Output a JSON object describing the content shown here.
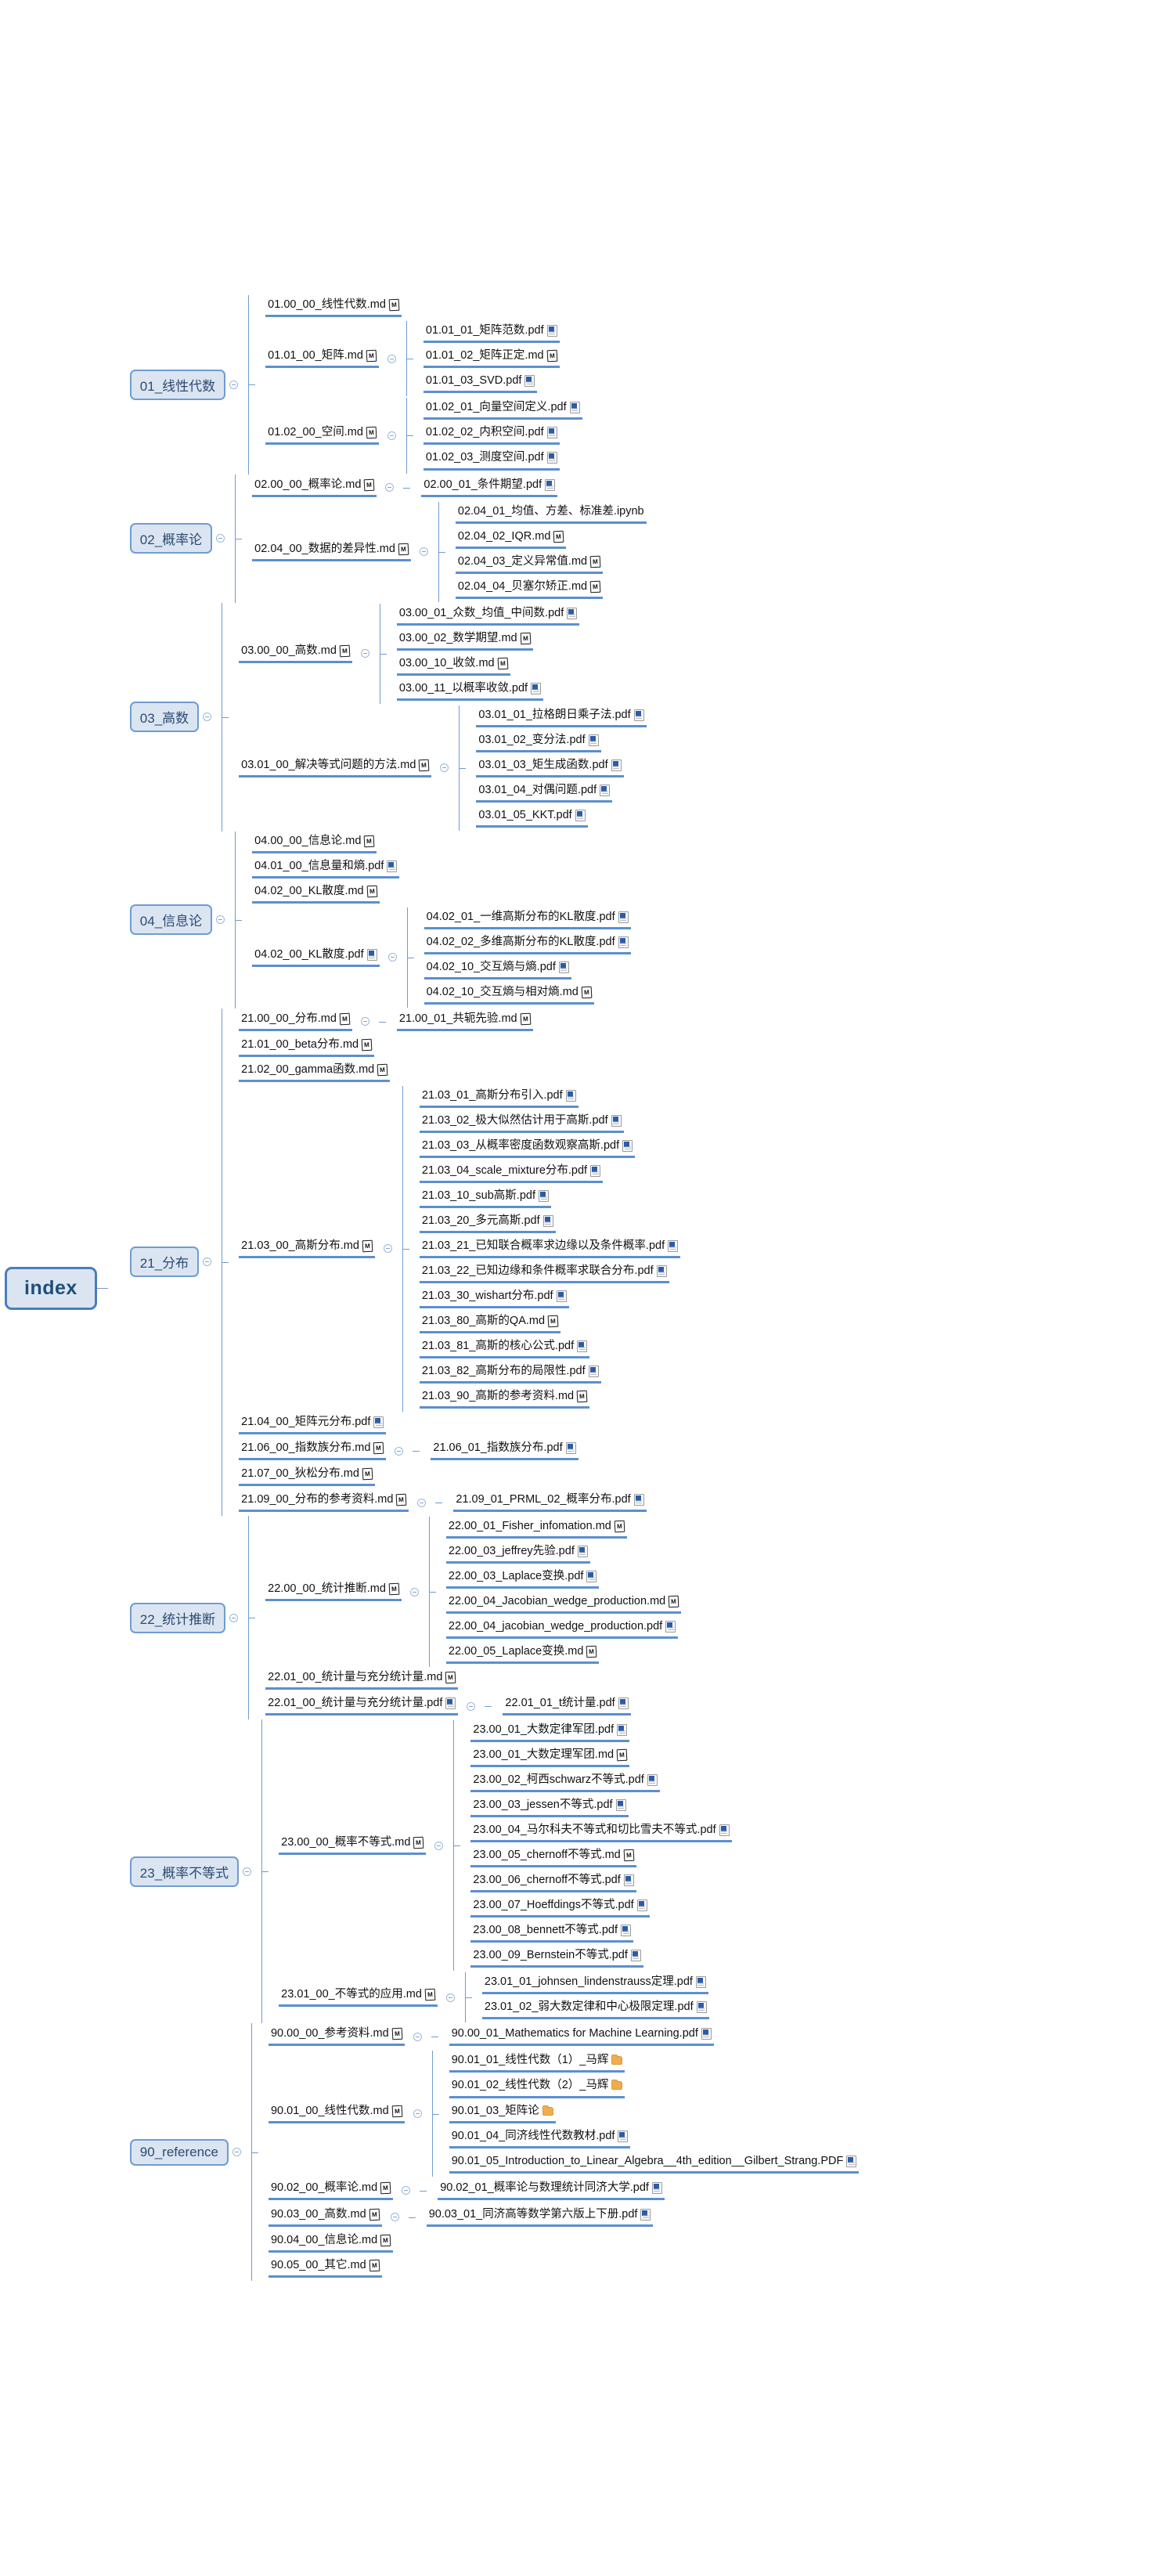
{
  "root": {
    "label": "index"
  },
  "colors": {
    "node_fill": "#dbe5f1",
    "node_border": "#6f9cd1",
    "root_border": "#4a7ebb",
    "root_text": "#1f4e79",
    "underline": "#5b8fd0",
    "connector": "#6f9cd1",
    "pdf_icon": "#2a5caa",
    "folder_icon": "#f0ad4e"
  },
  "toggle_label": "collapse-toggle",
  "branches": [
    {
      "label": "01_线性代数",
      "children": [
        {
          "label": "01.00_00_线性代数.md",
          "icon": "md-file-icon",
          "children": []
        },
        {
          "label": "01.01_00_矩阵.md",
          "icon": "md-file-icon",
          "children": [
            {
              "label": "01.01_01_矩阵范数.pdf",
              "icon": "pdf-file-icon"
            },
            {
              "label": "01.01_02_矩阵正定.md",
              "icon": "md-file-icon"
            },
            {
              "label": "01.01_03_SVD.pdf",
              "icon": "pdf-file-icon"
            }
          ]
        },
        {
          "label": "01.02_00_空间.md",
          "icon": "md-file-icon",
          "children": [
            {
              "label": "01.02_01_向量空间定义.pdf",
              "icon": "pdf-file-icon"
            },
            {
              "label": "01.02_02_内积空间.pdf",
              "icon": "pdf-file-icon"
            },
            {
              "label": "01.02_03_测度空间.pdf",
              "icon": "pdf-file-icon"
            }
          ]
        }
      ]
    },
    {
      "label": "02_概率论",
      "children": [
        {
          "label": "02.00_00_概率论.md",
          "icon": "md-file-icon",
          "children": [
            {
              "label": "02.00_01_条件期望.pdf",
              "icon": "pdf-file-icon"
            }
          ]
        },
        {
          "label": "02.04_00_数据的差异性.md",
          "icon": "md-file-icon",
          "children": [
            {
              "label": "02.04_01_均值、方差、标准差.ipynb",
              "icon": "none"
            },
            {
              "label": "02.04_02_IQR.md",
              "icon": "md-file-icon"
            },
            {
              "label": "02.04_03_定义异常值.md",
              "icon": "md-file-icon"
            },
            {
              "label": "02.04_04_贝塞尔矫正.md",
              "icon": "md-file-icon"
            }
          ]
        }
      ]
    },
    {
      "label": "03_高数",
      "children": [
        {
          "label": "03.00_00_高数.md",
          "icon": "md-file-icon",
          "children": [
            {
              "label": "03.00_01_众数_均值_中间数.pdf",
              "icon": "pdf-file-icon"
            },
            {
              "label": "03.00_02_数学期望.md",
              "icon": "md-file-icon"
            },
            {
              "label": "03.00_10_收敛.md",
              "icon": "md-file-icon"
            },
            {
              "label": "03.00_11_以概率收敛.pdf",
              "icon": "pdf-file-icon"
            }
          ]
        },
        {
          "label": "03.01_00_解决等式问题的方法.md",
          "icon": "md-file-icon",
          "children": [
            {
              "label": "03.01_01_拉格朗日乘子法.pdf",
              "icon": "pdf-file-icon"
            },
            {
              "label": "03.01_02_变分法.pdf",
              "icon": "pdf-file-icon"
            },
            {
              "label": "03.01_03_矩生成函数.pdf",
              "icon": "pdf-file-icon"
            },
            {
              "label": "03.01_04_对偶问题.pdf",
              "icon": "pdf-file-icon"
            },
            {
              "label": "03.01_05_KKT.pdf",
              "icon": "pdf-file-icon"
            }
          ]
        }
      ]
    },
    {
      "label": "04_信息论",
      "children": [
        {
          "label": "04.00_00_信息论.md",
          "icon": "md-file-icon",
          "children": []
        },
        {
          "label": "04.01_00_信息量和熵.pdf",
          "icon": "pdf-file-icon",
          "children": []
        },
        {
          "label": "04.02_00_KL散度.md",
          "icon": "md-file-icon",
          "children": []
        },
        {
          "label": "04.02_00_KL散度.pdf",
          "icon": "pdf-file-icon",
          "children": [
            {
              "label": "04.02_01_一维高斯分布的KL散度.pdf",
              "icon": "pdf-file-icon"
            },
            {
              "label": "04.02_02_多维高斯分布的KL散度.pdf",
              "icon": "pdf-file-icon"
            },
            {
              "label": "04.02_10_交互熵与熵.pdf",
              "icon": "pdf-file-icon"
            },
            {
              "label": "04.02_10_交互熵与相对熵.md",
              "icon": "md-file-icon"
            }
          ]
        }
      ]
    },
    {
      "label": "21_分布",
      "children": [
        {
          "label": "21.00_00_分布.md",
          "icon": "md-file-icon",
          "children": [
            {
              "label": "21.00_01_共轭先验.md",
              "icon": "md-file-icon"
            }
          ]
        },
        {
          "label": "21.01_00_beta分布.md",
          "icon": "md-file-icon",
          "children": []
        },
        {
          "label": "21.02_00_gamma函数.md",
          "icon": "md-file-icon",
          "children": []
        },
        {
          "label": "21.03_00_高斯分布.md",
          "icon": "md-file-icon",
          "children": [
            {
              "label": "21.03_01_高斯分布引入.pdf",
              "icon": "pdf-file-icon"
            },
            {
              "label": "21.03_02_极大似然估计用于高斯.pdf",
              "icon": "pdf-file-icon"
            },
            {
              "label": "21.03_03_从概率密度函数观察高斯.pdf",
              "icon": "pdf-file-icon"
            },
            {
              "label": "21.03_04_scale_mixture分布.pdf",
              "icon": "pdf-file-icon"
            },
            {
              "label": "21.03_10_sub高斯.pdf",
              "icon": "pdf-file-icon"
            },
            {
              "label": "21.03_20_多元高斯.pdf",
              "icon": "pdf-file-icon"
            },
            {
              "label": "21.03_21_已知联合概率求边缘以及条件概率.pdf",
              "icon": "pdf-file-icon"
            },
            {
              "label": "21.03_22_已知边缘和条件概率求联合分布.pdf",
              "icon": "pdf-file-icon"
            },
            {
              "label": "21.03_30_wishart分布.pdf",
              "icon": "pdf-file-icon"
            },
            {
              "label": "21.03_80_高斯的QA.md",
              "icon": "md-file-icon"
            },
            {
              "label": "21.03_81_高斯的核心公式.pdf",
              "icon": "pdf-file-icon"
            },
            {
              "label": "21.03_82_高斯分布的局限性.pdf",
              "icon": "pdf-file-icon"
            },
            {
              "label": "21.03_90_高斯的参考资料.md",
              "icon": "md-file-icon"
            }
          ]
        },
        {
          "label": "21.04_00_矩阵元分布.pdf",
          "icon": "pdf-file-icon",
          "children": []
        },
        {
          "label": "21.06_00_指数族分布.md",
          "icon": "md-file-icon",
          "children": [
            {
              "label": "21.06_01_指数族分布.pdf",
              "icon": "pdf-file-icon"
            }
          ]
        },
        {
          "label": "21.07_00_狄松分布.md",
          "icon": "md-file-icon",
          "children": []
        },
        {
          "label": "21.09_00_分布的参考资料.md",
          "icon": "md-file-icon",
          "children": [
            {
              "label": "21.09_01_PRML_02_概率分布.pdf",
              "icon": "pdf-file-icon"
            }
          ]
        }
      ]
    },
    {
      "label": "22_统计推断",
      "children": [
        {
          "label": "22.00_00_统计推断.md",
          "icon": "md-file-icon",
          "children": [
            {
              "label": "22.00_01_Fisher_infomation.md",
              "icon": "md-file-icon"
            },
            {
              "label": "22.00_03_jeffrey先验.pdf",
              "icon": "pdf-file-icon"
            },
            {
              "label": "22.00_03_Laplace变换.pdf",
              "icon": "pdf-file-icon"
            },
            {
              "label": "22.00_04_Jacobian_wedge_production.md",
              "icon": "md-file-icon"
            },
            {
              "label": "22.00_04_jacobian_wedge_production.pdf",
              "icon": "pdf-file-icon"
            },
            {
              "label": "22.00_05_Laplace变换.md",
              "icon": "md-file-icon"
            }
          ]
        },
        {
          "label": "22.01_00_统计量与充分统计量.md",
          "icon": "md-file-icon",
          "children": []
        },
        {
          "label": "22.01_00_统计量与充分统计量.pdf",
          "icon": "pdf-file-icon",
          "children": [
            {
              "label": "22.01_01_t统计量.pdf",
              "icon": "pdf-file-icon"
            }
          ]
        }
      ]
    },
    {
      "label": "23_概率不等式",
      "children": [
        {
          "label": "23.00_00_概率不等式.md",
          "icon": "md-file-icon",
          "children": [
            {
              "label": "23.00_01_大数定律军团.pdf",
              "icon": "pdf-file-icon"
            },
            {
              "label": "23.00_01_大数定理军团.md",
              "icon": "md-file-icon"
            },
            {
              "label": "23.00_02_柯西schwarz不等式.pdf",
              "icon": "pdf-file-icon"
            },
            {
              "label": "23.00_03_jessen不等式.pdf",
              "icon": "pdf-file-icon"
            },
            {
              "label": "23.00_04_马尔科夫不等式和切比雪夫不等式.pdf",
              "icon": "pdf-file-icon"
            },
            {
              "label": "23.00_05_chernoff不等式.md",
              "icon": "md-file-icon"
            },
            {
              "label": "23.00_06_chernoff不等式.pdf",
              "icon": "pdf-file-icon"
            },
            {
              "label": "23.00_07_Hoeffdings不等式.pdf",
              "icon": "pdf-file-icon"
            },
            {
              "label": "23.00_08_bennett不等式.pdf",
              "icon": "pdf-file-icon"
            },
            {
              "label": "23.00_09_Bernstein不等式.pdf",
              "icon": "pdf-file-icon"
            }
          ]
        },
        {
          "label": "23.01_00_不等式的应用.md",
          "icon": "md-file-icon",
          "children": [
            {
              "label": "23.01_01_johnsen_lindenstrauss定理.pdf",
              "icon": "pdf-file-icon"
            },
            {
              "label": "23.01_02_弱大数定律和中心极限定理.pdf",
              "icon": "pdf-file-icon"
            }
          ]
        }
      ]
    },
    {
      "label": "90_reference",
      "children": [
        {
          "label": "90.00_00_参考资料.md",
          "icon": "md-file-icon",
          "children": [
            {
              "label": "90.00_01_Mathematics for Machine Learning.pdf",
              "icon": "pdf-file-icon"
            }
          ]
        },
        {
          "label": "90.01_00_线性代数.md",
          "icon": "md-file-icon",
          "children": [
            {
              "label": "90.01_01_线性代数（1）_马辉",
              "icon": "folder-icon"
            },
            {
              "label": "90.01_02_线性代数（2）_马辉",
              "icon": "folder-icon"
            },
            {
              "label": "90.01_03_矩阵论",
              "icon": "folder-icon"
            },
            {
              "label": "90.01_04_同济线性代数教材.pdf",
              "icon": "pdf-file-icon"
            },
            {
              "label": "90.01_05_Introduction_to_Linear_Algebra__4th_edition__Gilbert_Strang.PDF",
              "icon": "pdf-file-icon"
            }
          ]
        },
        {
          "label": "90.02_00_概率论.md",
          "icon": "md-file-icon",
          "children": [
            {
              "label": "90.02_01_概率论与数理统计同济大学.pdf",
              "icon": "pdf-file-icon"
            }
          ]
        },
        {
          "label": "90.03_00_高数.md",
          "icon": "md-file-icon",
          "children": [
            {
              "label": "90.03_01_同济高等数学第六版上下册.pdf",
              "icon": "pdf-file-icon"
            }
          ]
        },
        {
          "label": "90.04_00_信息论.md",
          "icon": "md-file-icon",
          "children": []
        },
        {
          "label": "90.05_00_其它.md",
          "icon": "md-file-icon",
          "children": []
        }
      ]
    }
  ]
}
